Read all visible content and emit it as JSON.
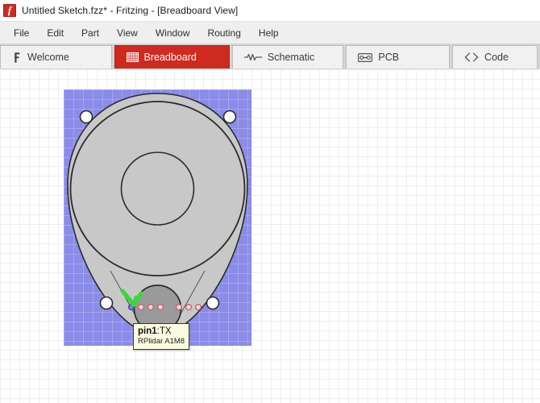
{
  "window": {
    "icon": "fritzing-logo-icon",
    "title": "Untitled Sketch.fzz* - Fritzing - [Breadboard View]"
  },
  "menubar": {
    "items": [
      {
        "label": "File"
      },
      {
        "label": "Edit"
      },
      {
        "label": "Part"
      },
      {
        "label": "View"
      },
      {
        "label": "Window"
      },
      {
        "label": "Routing"
      },
      {
        "label": "Help"
      }
    ]
  },
  "tabs": [
    {
      "label": "Welcome",
      "icon": "fritzing-f-icon",
      "active": false
    },
    {
      "label": "Breadboard",
      "icon": "breadboard-icon",
      "active": true
    },
    {
      "label": "Schematic",
      "icon": "resistor-icon",
      "active": false
    },
    {
      "label": "PCB",
      "icon": "pcb-icon",
      "active": false
    },
    {
      "label": "Code",
      "icon": "angle-brackets-icon",
      "active": false
    }
  ],
  "canvas": {
    "grid_visible": true,
    "grid_spacing_px": 12,
    "background_color": "#ffffff",
    "grid_color": "#eeeeee"
  },
  "part": {
    "name": "RPlidar A1M8",
    "selected": true,
    "selection_color": "#8b8be8",
    "body_color": "#c8c8c8",
    "outline_color": "#2b2b2b",
    "hub_color": "#9a9a9a",
    "mounting_hole_color": "#ffffff",
    "mounting_holes": 4,
    "connector_groups": [
      {
        "name": "left-connector-group",
        "pins": [
          {
            "label": "pin1",
            "state": "hovered",
            "color": "#5a5ad8"
          },
          {
            "label": "pin2",
            "state": "normal",
            "color": "#d06a72"
          },
          {
            "label": "pin3",
            "state": "normal",
            "color": "#d06a72"
          },
          {
            "label": "pin4",
            "state": "normal",
            "color": "#d06a72"
          }
        ]
      },
      {
        "name": "right-connector-group",
        "pins": [
          {
            "label": "pin5",
            "state": "normal",
            "color": "#d06a72"
          },
          {
            "label": "pin6",
            "state": "normal",
            "color": "#d06a72"
          },
          {
            "label": "pin7",
            "state": "normal",
            "color": "#d06a72"
          }
        ]
      }
    ]
  },
  "cursor": {
    "type": "arrow-cursor",
    "color": "#3cd63c"
  },
  "tooltip": {
    "pin_label": "pin1",
    "pin_separator": ":",
    "pin_signal": "TX",
    "part_name": "RPlidar A1M8",
    "background_color": "#fbfbe2",
    "border_color": "#3a3a3a"
  }
}
